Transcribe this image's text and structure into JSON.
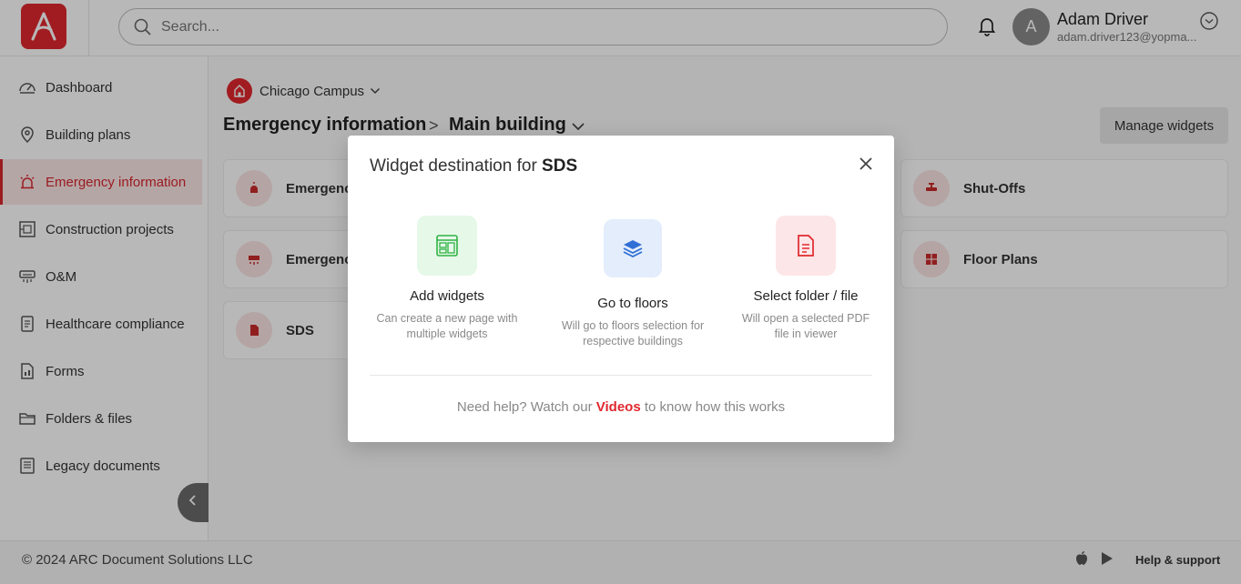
{
  "header": {
    "search_placeholder": "Search...",
    "user": {
      "initial": "A",
      "name": "Adam Driver",
      "email": "adam.driver123@yopma..."
    }
  },
  "sidebar": {
    "items": [
      {
        "label": "Dashboard",
        "icon": "dashboard-icon"
      },
      {
        "label": "Building plans",
        "icon": "location-pin-icon"
      },
      {
        "label": "Emergency information",
        "icon": "alarm-icon",
        "active": true
      },
      {
        "label": "Construction projects",
        "icon": "construction-icon"
      },
      {
        "label": "O&M",
        "icon": "hvac-icon"
      },
      {
        "label": "Healthcare compliance",
        "icon": "checklist-icon"
      },
      {
        "label": "Forms",
        "icon": "form-icon"
      },
      {
        "label": "Folders & files",
        "icon": "folder-icon"
      },
      {
        "label": "Legacy documents",
        "icon": "documents-icon"
      }
    ]
  },
  "main": {
    "campus": "Chicago Campus",
    "breadcrumb": {
      "section": "Emergency information",
      "separator": ">",
      "building": "Main building"
    },
    "manage_widgets": "Manage widgets",
    "cards": [
      {
        "label": "Emergenc",
        "icon": "alarm-icon"
      },
      {
        "label": "Shut-Offs",
        "icon": "valve-icon"
      },
      {
        "label": "Emergenc",
        "icon": "generator-icon"
      },
      {
        "label": "Floor Plans",
        "icon": "floor-plan-icon"
      },
      {
        "label": "SDS",
        "icon": "sds-icon"
      }
    ]
  },
  "modal": {
    "title_prefix": "Widget destination for ",
    "title_target": "SDS",
    "options": [
      {
        "title": "Add widgets",
        "desc_line1": "Can create a new page with",
        "desc_line2": "multiple widgets",
        "icon": "widgets-icon",
        "color": "#2fb344"
      },
      {
        "title": "Go to floors",
        "desc_line1": "Will go to floors selection for",
        "desc_line2": "respective buildings",
        "icon": "layers-icon",
        "color": "#2f6fd6"
      },
      {
        "title": "Select folder / file",
        "desc_line1": "Will open a selected PDF",
        "desc_line2": "file in viewer",
        "icon": "file-icon",
        "color": "#e0282e"
      }
    ],
    "help_prefix": "Need help? Watch our ",
    "help_link": "Videos",
    "help_suffix": " to know how this works"
  },
  "footer": {
    "copyright": "© 2024 ARC Document Solutions LLC",
    "help": "Help & support"
  }
}
